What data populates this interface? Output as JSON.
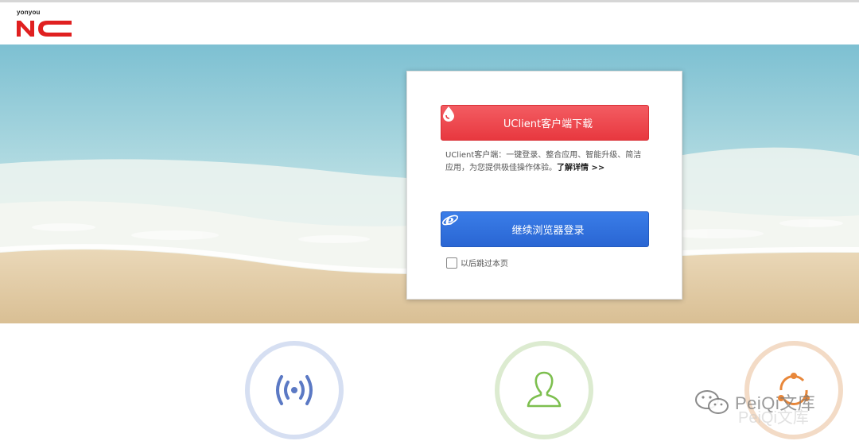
{
  "header": {
    "logo_brand": "yonyou",
    "logo_text": "NC"
  },
  "card": {
    "download_button_label": "UClient客户端下载",
    "description": "UClient客户端：一键登录、整合应用、智能升级、简洁应用，为您提供极佳操作体验。",
    "learn_more": "了解详情 >>",
    "browser_login_label": "继续浏览器登录",
    "skip_label": "以后跳过本页"
  },
  "features": [
    {
      "icon": "wireless-signal-icon",
      "color": "#5b79c4"
    },
    {
      "icon": "user-icon",
      "color": "#7dbf4f"
    },
    {
      "icon": "sync-icon",
      "color": "#e8873a"
    }
  ],
  "watermark": {
    "text": "PeiQi文库",
    "text_shadow": "PeiQi文库"
  },
  "colors": {
    "download_button": "#e8383f",
    "login_button": "#2a66d3",
    "logo_red": "#e02020"
  }
}
